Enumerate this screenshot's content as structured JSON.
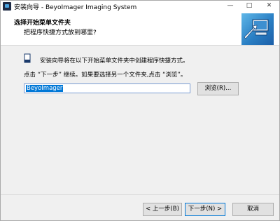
{
  "window": {
    "title": "安装向导 - BeyoImager Imaging System",
    "minimize_icon": "minimize-icon",
    "maximize_icon": "maximize-icon",
    "close_icon": "close-icon"
  },
  "header": {
    "title": "选择开始菜单文件夹",
    "subtitle": "把程序快捷方式放到哪里?"
  },
  "body": {
    "intro": "安装向导将在以下开始菜单文件夹中创建程序快捷方式。",
    "hint": "点击 “下一步” 继续。如果要选择另一个文件夹,点击 “浏览”。",
    "folder_value": "BeyoImager",
    "browse_label": "浏览(R)..."
  },
  "footer": {
    "back_label": "< 上一步(B)",
    "next_label": "下一步(N) >",
    "cancel_label": "取消"
  },
  "colors": {
    "selection": "#0078d7",
    "logo_blue": "#2a7fc4"
  }
}
